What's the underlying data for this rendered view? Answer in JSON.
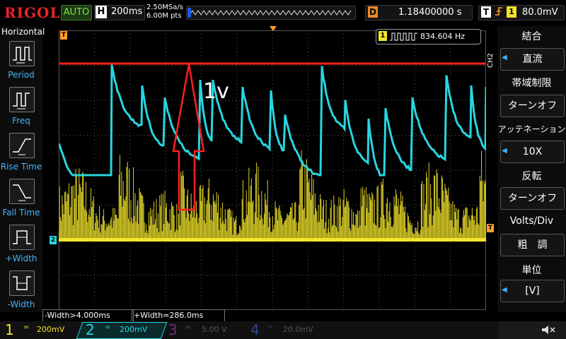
{
  "header": {
    "brand": "RIGOL",
    "run_mode": "AUTO",
    "timebase_letter": "H",
    "timebase": "200ms",
    "sample_rate": "2.50MSa/s",
    "memory_depth": "6.00M pts",
    "delay_letter": "D",
    "delay": "1.18400000 s",
    "trigger_letter": "T",
    "trigger_source": "1",
    "trigger_level": "80.0mV"
  },
  "left_menu": {
    "title": "Horizontal",
    "items": [
      {
        "label": "Period",
        "icon": "period-icon"
      },
      {
        "label": "Freq",
        "icon": "freq-icon"
      },
      {
        "label": "Rise Time",
        "icon": "rise-time-icon"
      },
      {
        "label": "Fall Time",
        "icon": "fall-time-icon"
      },
      {
        "label": "+Width",
        "icon": "pos-width-icon"
      },
      {
        "label": "-Width",
        "icon": "neg-width-icon"
      }
    ]
  },
  "right_menu": {
    "channel_tag": "CH2",
    "items": [
      {
        "title": "結合",
        "value": "直流",
        "has_arrow": true
      },
      {
        "title": "帯域制限",
        "value": "ターンオフ",
        "has_arrow": false
      },
      {
        "title": "アッテネーション",
        "value": "10X",
        "has_arrow": true
      },
      {
        "title": "反転",
        "value": "ターンオフ",
        "has_arrow": false
      },
      {
        "title": "Volts/Div",
        "value": "粗　調",
        "has_arrow": false
      },
      {
        "title": "単位",
        "value": "[V]",
        "has_arrow": true
      }
    ]
  },
  "frequency_counter": {
    "channel": "1",
    "value": "834.604 Hz"
  },
  "measurements": {
    "neg_width": "-Width>4.000ms",
    "pos_width": "+Width=286.0ms"
  },
  "annotation": {
    "text": "1v",
    "color": "#ff2020"
  },
  "markers": {
    "trigger_marker": "T",
    "ch2_ground_marker": "2",
    "trigger_level_marker": "T"
  },
  "channels": [
    {
      "num": "1",
      "coupling": "=",
      "scale": "200mV",
      "color": "#f2e42a",
      "active": true
    },
    {
      "num": "2",
      "coupling": "=",
      "scale": "200mV",
      "color": "#27d6e0",
      "active": true
    },
    {
      "num": "3",
      "coupling": "=",
      "scale": "5.00 V",
      "color": "#a24fbf",
      "active": false
    },
    {
      "num": "4",
      "coupling": "~",
      "scale": "20.0mV",
      "color": "#3f63c8",
      "active": false
    }
  ],
  "colors": {
    "ch1": "#f2e42a",
    "ch2": "#27d6e0",
    "accent": "#3fb6ff",
    "trigger": "#ff9f2a",
    "annotation": "#ff2020"
  }
}
